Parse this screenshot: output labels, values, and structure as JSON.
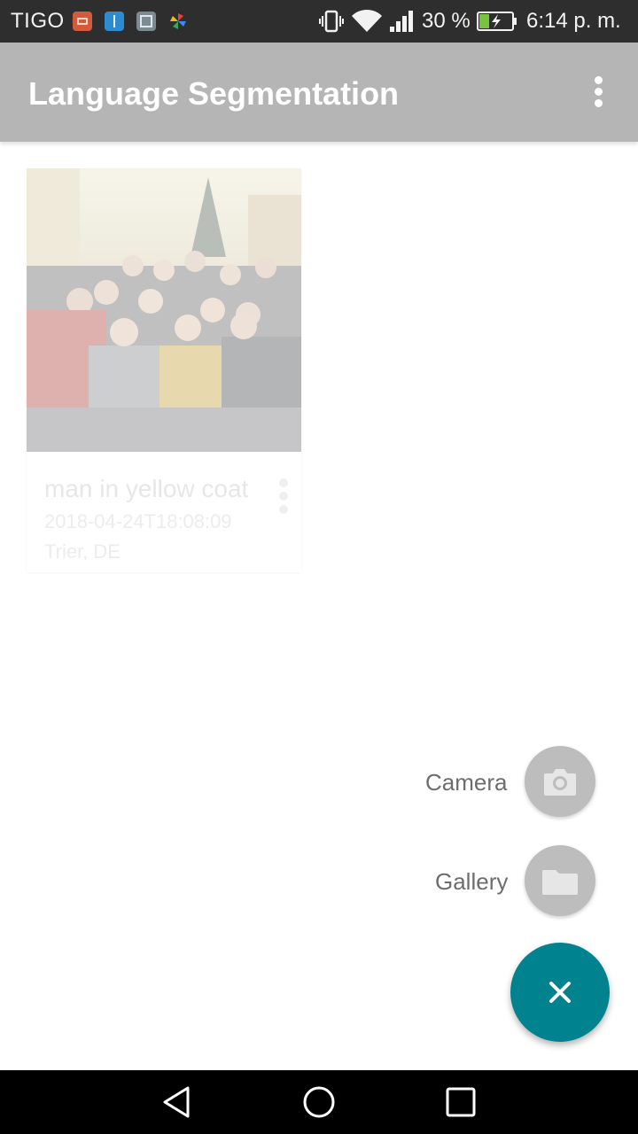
{
  "status_bar": {
    "carrier": "TIGO",
    "battery_percent": "30 %",
    "battery_level": 0.3,
    "time": "6:14 p. m.",
    "icons": [
      "mail-notification-icon",
      "usb-notification-icon",
      "gallery-notification-icon",
      "pinwheel-icon",
      "vibrate-icon",
      "wifi-icon",
      "signal-icon",
      "battery-charging-icon"
    ]
  },
  "app_bar": {
    "title": "Language Segmentation",
    "overflow_icon": "more-vert-icon"
  },
  "cards": [
    {
      "title": "man in yellow coat",
      "date": "2018-04-24T18:08:09",
      "location": "Trier, DE"
    }
  ],
  "fab_menu": {
    "camera_label": "Camera",
    "gallery_label": "Gallery",
    "camera_icon": "camera-icon",
    "gallery_icon": "folder-icon",
    "close_icon": "close-icon"
  },
  "colors": {
    "app_bar": "#5b5b5b",
    "status_bar": "#2e2e2e",
    "fab": "#00838f",
    "mini_fab": "#bdbdbd"
  },
  "nav_bar": {
    "icons": [
      "back-icon",
      "home-icon",
      "recents-icon"
    ]
  }
}
